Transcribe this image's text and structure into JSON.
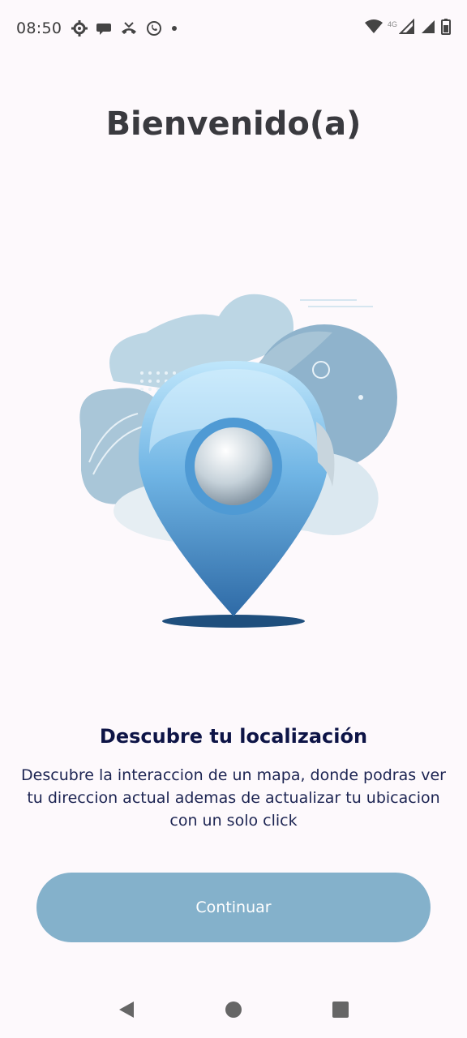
{
  "status_bar": {
    "time": "08:50",
    "network_label": "4G",
    "icons_left": [
      "settings-icon",
      "message-icon",
      "missed-call-icon",
      "whatsapp-icon",
      "dot-icon"
    ],
    "icons_right": [
      "wifi-icon",
      "signal-icon",
      "signal-icon",
      "battery-icon"
    ]
  },
  "screen": {
    "title": "Bienvenido(a)",
    "illustration": "location-pin-icon",
    "subtitle": "Descubre tu localización",
    "description": "Descubre la interaccion de un mapa, donde podras ver tu direccion actual ademas de actualizar tu ubicacion con un solo click",
    "continue_label": "Continuar"
  },
  "colors": {
    "background": "#fdf9fc",
    "button": "#84b1cb",
    "title": "#3a3a3f",
    "subtitle": "#0d1446"
  },
  "nav_bar": {
    "buttons": [
      "back-icon",
      "home-icon",
      "recents-icon"
    ]
  }
}
